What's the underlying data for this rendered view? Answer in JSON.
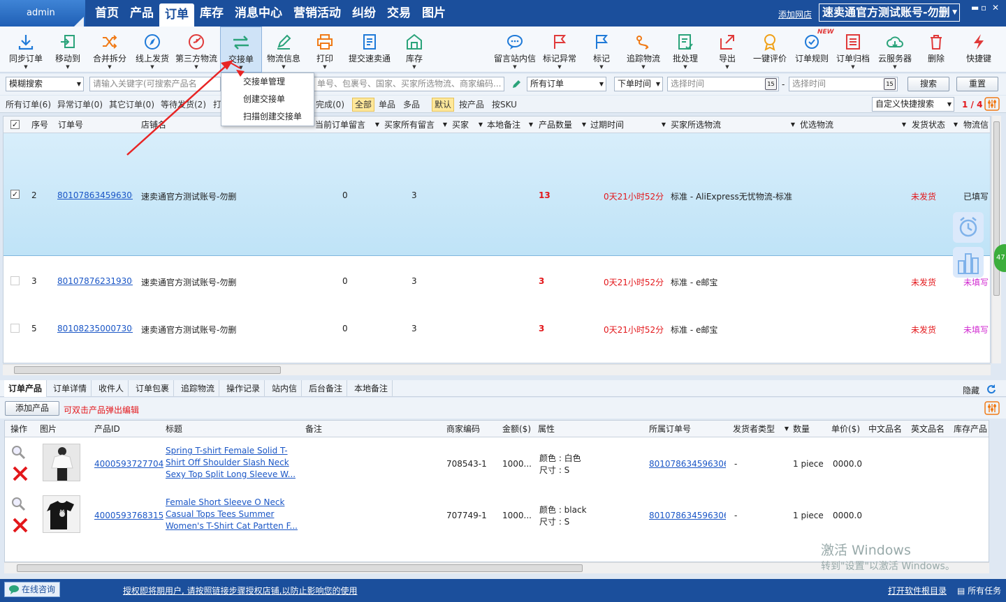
{
  "titlebar": {
    "admin": "admin",
    "nav": [
      "首页",
      "产品",
      "订单",
      "库存",
      "消息中心",
      "营销活动",
      "纠纷",
      "交易",
      "图片"
    ],
    "active_index": 2,
    "add_shop": "添加网店",
    "account": "速卖通官方测试账号-勿删"
  },
  "toolbar": {
    "left": [
      {
        "name": "sync-orders",
        "label": "同步订单",
        "icon": "download-icon",
        "arrow": true
      },
      {
        "name": "move-to",
        "label": "移动到",
        "icon": "move-icon",
        "arrow": true
      },
      {
        "name": "merge-split",
        "label": "合并拆分",
        "icon": "shuffle-icon",
        "arrow": true
      },
      {
        "name": "online-ship",
        "label": "线上发货",
        "icon": "compass-icon",
        "arrow": true
      },
      {
        "name": "third-party-logistics",
        "label": "第三方物流",
        "icon": "target-icon",
        "arrow": true
      },
      {
        "name": "handover",
        "label": "交接单",
        "icon": "swap-icon",
        "arrow": true,
        "selected": true
      },
      {
        "name": "logistics-info",
        "label": "物流信息",
        "icon": "pen-icon",
        "arrow": true
      },
      {
        "name": "print",
        "label": "打印",
        "icon": "printer-icon",
        "arrow": true
      },
      {
        "name": "submit-smt",
        "label": "提交速卖通",
        "icon": "document-icon",
        "arrow": false
      },
      {
        "name": "inventory",
        "label": "库存",
        "icon": "warehouse-icon",
        "arrow": true
      }
    ],
    "right": [
      {
        "name": "leave-message",
        "label": "留言站内信",
        "icon": "chat-icon",
        "arrow": true
      },
      {
        "name": "mark-abnormal",
        "label": "标记异常",
        "icon": "red-flag-icon",
        "arrow": true
      },
      {
        "name": "mark",
        "label": "标记",
        "icon": "blue-flag-icon",
        "arrow": true
      },
      {
        "name": "track-logistics",
        "label": "追踪物流",
        "icon": "track-icon",
        "arrow": true
      },
      {
        "name": "batch-process",
        "label": "批处理",
        "icon": "batch-icon",
        "arrow": true
      },
      {
        "name": "export",
        "label": "导出",
        "icon": "export-icon",
        "arrow": true
      },
      {
        "name": "one-click-review",
        "label": "一键评价",
        "icon": "medal-icon",
        "arrow": false
      },
      {
        "name": "order-rules",
        "label": "订单规则",
        "icon": "rules-icon",
        "arrow": false,
        "badge": "NEW"
      },
      {
        "name": "order-archive",
        "label": "订单归档",
        "icon": "archive-icon",
        "arrow": true
      },
      {
        "name": "cloud-server",
        "label": "云服务器",
        "icon": "cloud-icon",
        "arrow": true
      },
      {
        "name": "delete",
        "label": "删除",
        "icon": "trash-icon",
        "arrow": false
      },
      {
        "name": "shortcut",
        "label": "快捷键",
        "icon": "lightning-icon",
        "arrow": false
      }
    ]
  },
  "dropdown": {
    "items": [
      "交接单管理",
      "创建交接单",
      "扫描创建交接单"
    ]
  },
  "filter": {
    "search_mode": "模糊搜索",
    "search_placeholder_left": "请输入关键字(可搜索产品名",
    "search_placeholder_right": "单号、包裹号、国家、买家所选物流、商家编码...",
    "all_orders": "所有订单",
    "order_time": "下单时间",
    "select_time_1": "选择时间",
    "select_time_2": "选择时间",
    "search_btn": "搜索",
    "reset_btn": "重置",
    "date_dash": "-"
  },
  "tabs": {
    "all": "所有订单(6)",
    "abnormal": "异常订单(0)",
    "other": "其它订单(0)",
    "waiting": "等待发货(2)",
    "partial": "打",
    "completed": "完成(0)",
    "all_type": "全部",
    "single": "单品",
    "multi": "多品",
    "default": "默认",
    "by_product": "按产品",
    "by_sku": "按SKU",
    "custom_search": "自定义快捷搜索",
    "page": "1 / 4"
  },
  "grid": {
    "headers": [
      "序号",
      "订单号",
      "店铺名",
      "",
      "当前订单留言",
      "买家所有留言",
      "买家",
      "本地备注",
      "产品数量",
      "过期时间",
      "买家所选物流",
      "优选物流",
      "发货状态",
      "物流信"
    ],
    "rows": [
      {
        "seq": "2",
        "order": "801078634596306",
        "shop": "速卖通官方测试账号-勿删",
        "msg": "0",
        "allmsg": "3",
        "qty": "13",
        "expire": "0天21小时52分",
        "logistics": "标准 - AliExpress无忧物流-标准",
        "status": "未发货",
        "info": "已填写",
        "checked": true
      },
      {
        "seq": "3",
        "order": "801078762319306",
        "shop": "速卖通官方测试账号-勿删",
        "msg": "0",
        "allmsg": "3",
        "qty": "3",
        "expire": "0天21小时52分",
        "logistics": "标准 - e邮宝",
        "status": "未发货",
        "info": "未填写",
        "checked": false
      },
      {
        "seq": "5",
        "order": "801082350007306",
        "shop": "速卖通官方测试账号-勿删",
        "msg": "0",
        "allmsg": "3",
        "qty": "3",
        "expire": "0天21小时52分",
        "logistics": "标准 - e邮宝",
        "status": "未发货",
        "info": "未填写",
        "checked": false
      }
    ]
  },
  "bottom": {
    "tabs": [
      "订单产品",
      "订单详情",
      "收件人",
      "订单包裹",
      "追踪物流",
      "操作记录",
      "站内信",
      "后台备注",
      "本地备注"
    ],
    "hide": "隐藏",
    "add_product": "添加产品",
    "edit_hint": "可双击产品弹出编辑",
    "headers": [
      "操作",
      "图片",
      "产品ID",
      "标题",
      "备注",
      "商家编码",
      "金额($)",
      "属性",
      "所属订单号",
      "发货者类型",
      "数量",
      "单价($)",
      "中文品名",
      "英文品名",
      "库存产品"
    ],
    "products": [
      {
        "id": "4000593727704",
        "title": [
          "Spring T-shirt Female Solid T-",
          "Shirt Off Shoulder Slash Neck",
          "Sexy Top Split Long Sleeve W..."
        ],
        "code": "708543-1",
        "amount": "1000...",
        "attr1": "颜色 : 白色",
        "attr2": "尺寸 : S",
        "order": "801078634596306",
        "sender": "-",
        "qty": "1 piece",
        "price": "0000.0"
      },
      {
        "id": "4000593768315",
        "title": [
          "Female Short Sleeve O Neck",
          "Casual Tops Tees Summer",
          "Women's T-Shirt Cat Partten F..."
        ],
        "code": "707749-1",
        "amount": "1000...",
        "attr1": "颜色 : black",
        "attr2": "尺寸 : S",
        "order": "801078634596306",
        "sender": "-",
        "qty": "1 piece",
        "price": "0000.0"
      }
    ]
  },
  "watermark": {
    "line1": "激活 Windows",
    "line2": "转到\"设置\"以激活 Windows。"
  },
  "status": {
    "online": "在线咨询",
    "notice": "授权即将期用户, 请按照链接步骤授权店铺,以防止影响您的使用",
    "open_log": "打开软件根目录",
    "all_tasks": "所有任务"
  }
}
